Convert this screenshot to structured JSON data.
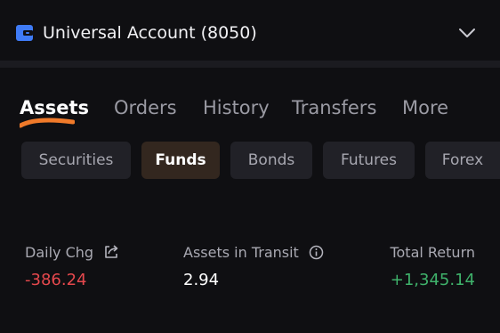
{
  "header": {
    "account_title": "Universal Account (8050)",
    "icons": {
      "wallet": "wallet-icon",
      "expand": "chevron-down-icon"
    },
    "wallet_color": "#3f7bf6"
  },
  "tabs": [
    {
      "label": "Assets",
      "active": true
    },
    {
      "label": "Orders",
      "active": false
    },
    {
      "label": "History",
      "active": false
    },
    {
      "label": "Transfers",
      "active": false
    },
    {
      "label": "More",
      "active": false
    }
  ],
  "filters": [
    {
      "label": "Securities",
      "active": false
    },
    {
      "label": "Funds",
      "active": true
    },
    {
      "label": "Bonds",
      "active": false
    },
    {
      "label": "Futures",
      "active": false
    },
    {
      "label": "Forex",
      "active": false
    }
  ],
  "stats": {
    "daily_chg": {
      "label": "Daily Chg",
      "value": "-386.24",
      "color": "#e5484d",
      "icon": "share-icon"
    },
    "assets_in_transit": {
      "label": "Assets in Transit",
      "value": "2.94",
      "color": "#ffffff",
      "icon": "info-icon"
    },
    "total_return": {
      "label": "Total Return",
      "value": "+1,345.14",
      "color": "#3fb26b"
    }
  },
  "colors": {
    "accent_underline": "#f07a2a",
    "active_chip_bg": "#33271f",
    "background": "#0f0f12"
  }
}
